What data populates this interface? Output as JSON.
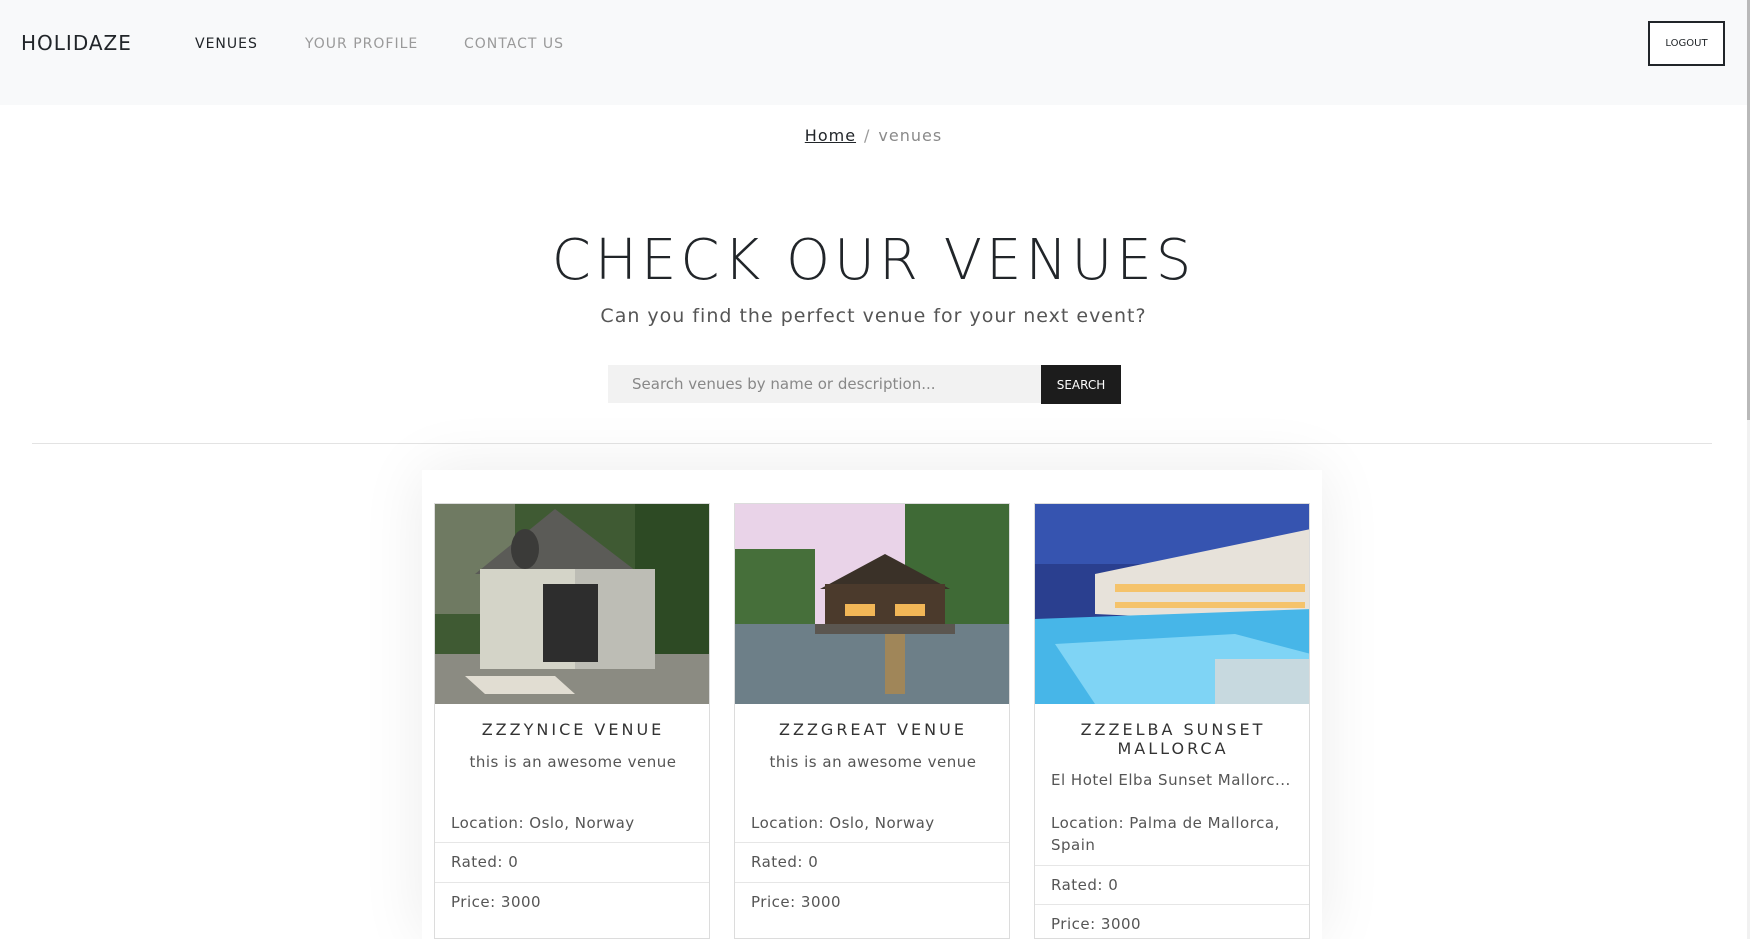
{
  "nav": {
    "brand": "HOLIDAZE",
    "links": [
      "VENUES",
      "YOUR PROFILE",
      "CONTACT US"
    ],
    "logout": "LOGOUT"
  },
  "breadcrumb": {
    "home": "Home",
    "separator": "/",
    "current": "venues"
  },
  "header": {
    "title": "CHECK OUR VENUES",
    "subtitle": "Can you find the perfect venue for your next event?"
  },
  "search": {
    "placeholder": "Search venues by name or description...",
    "button": "SEARCH"
  },
  "venues": [
    {
      "name": "ZZZYNICE VENUE",
      "description": "this is an awesome venue",
      "location": "Location: Oslo, Norway",
      "rated": "Rated: 0",
      "price": "Price: 3000",
      "image": "tiny-house-photo"
    },
    {
      "name": "ZZZGREAT VENUE",
      "description": "this is an awesome venue",
      "location": "Location: Oslo, Norway",
      "rated": "Rated: 0",
      "price": "Price: 3000",
      "image": "lake-house-photo"
    },
    {
      "name": "ZZZELBA SUNSET MALLORCA",
      "description": "El Hotel Elba Sunset Mallorc...",
      "location": "Location: Palma de Mallorca, Spain",
      "rated": "Rated: 0",
      "price": "Price: 3000",
      "image": "hotel-pool-photo"
    }
  ]
}
